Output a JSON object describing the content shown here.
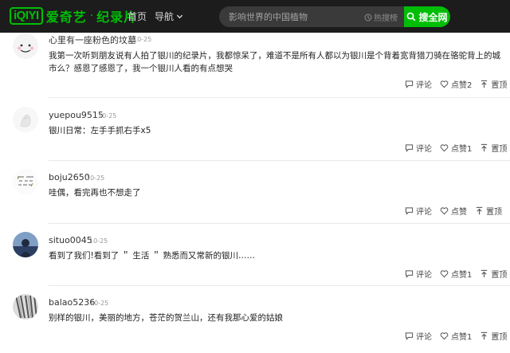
{
  "header": {
    "logo_mark": "iQIYI",
    "logo_brand": "爱奇艺",
    "logo_dot": "·",
    "logo_channel": "纪录片",
    "nav_home": "首页",
    "nav_guide": "导航",
    "search_placeholder": "影响世界的中国植物",
    "hot_list": "热搜榜",
    "search_button": "搜全网",
    "accent_color": "#00be06",
    "bar_color": "#1c1c1c"
  },
  "comments": [
    {
      "username": "心里有一座粉色的坟墓",
      "time": "10-25",
      "text": "我第一次听到朋友说有人拍了银川的纪录片，我都惊呆了，难道不是所有人都以为银川是个背着宽背猎刀骑在骆驼背上的城市么？感恩了感恩了，我一个银川人看的有点想哭",
      "reply": "评论",
      "like": "点赞2",
      "top": "置顶"
    },
    {
      "username": "yuepou9515",
      "time": "10-25",
      "text": "银川日常：左手手抓右手x5",
      "reply": "评论",
      "like": "点赞1",
      "top": "置顶"
    },
    {
      "username": "boju2650",
      "time": "10-25",
      "text": "哇偶，看完再也不想走了",
      "reply": "评论",
      "like": "点赞",
      "top": "置顶"
    },
    {
      "username": "situo0045",
      "time": "10-25",
      "text": "看到了我们!看到了 ＂ 生活 ＂ 熟悉而又常新的银川……",
      "reply": "评论",
      "like": "点赞1",
      "top": "置顶"
    },
    {
      "username": "balao5236",
      "time": "10-25",
      "text": "别样的银川，美丽的地方，苍茫的贺兰山，还有我那心爱的姑娘",
      "reply": "评论",
      "like": "点赞1",
      "top": "置顶"
    }
  ]
}
